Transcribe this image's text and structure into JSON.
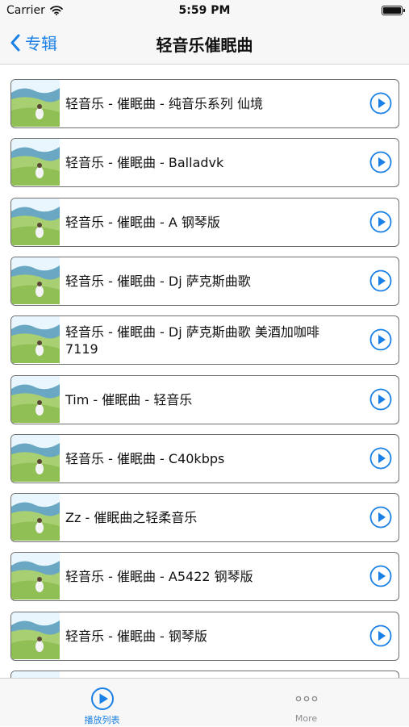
{
  "status_bar": {
    "carrier": "Carrier",
    "time": "5:59 PM"
  },
  "nav": {
    "back_label": "专辑",
    "title": "轻音乐催眠曲"
  },
  "tracks": [
    {
      "title": "轻音乐 - 催眠曲 - 纯音乐系列 仙境"
    },
    {
      "title": "轻音乐 - 催眠曲 - Balladvk"
    },
    {
      "title": "轻音乐 - 催眠曲 - A 钢琴版"
    },
    {
      "title": "轻音乐 - 催眠曲 - Dj 萨克斯曲歌"
    },
    {
      "title": "轻音乐 - 催眠曲 - Dj 萨克斯曲歌 美酒加咖啡 7119"
    },
    {
      "title": "Tim - 催眠曲 - 轻音乐"
    },
    {
      "title": "轻音乐 - 催眠曲 - C40kbps"
    },
    {
      "title": "Zz - 催眠曲之轻柔音乐"
    },
    {
      "title": "轻音乐 - 催眠曲 - A5422 钢琴版"
    },
    {
      "title": "轻音乐 - 催眠曲 - 钢琴版"
    },
    {
      "title": ""
    }
  ],
  "tab_bar": {
    "tabs": [
      {
        "label": "播放列表",
        "icon": "play-circle-icon",
        "active": true
      },
      {
        "label": "More",
        "icon": "more-dots-icon",
        "active": false
      }
    ]
  },
  "colors": {
    "accent": "#1a80e6",
    "inactive": "#8e8e93",
    "row_border": "#6f6f6f"
  }
}
